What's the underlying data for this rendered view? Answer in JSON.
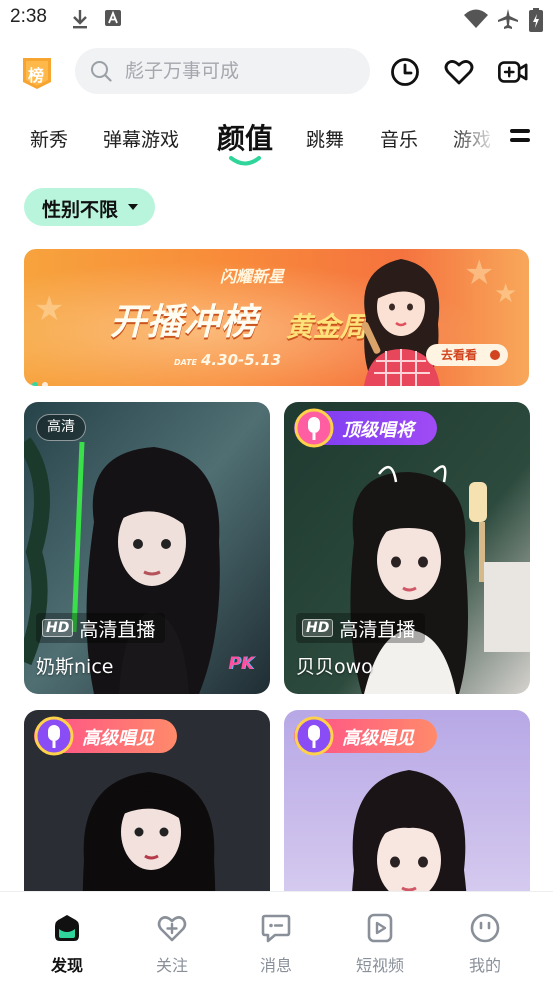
{
  "status_bar": {
    "time": "2:38",
    "icons": [
      "download-icon",
      "text-a-icon",
      "wifi-icon",
      "airplane-mode-icon",
      "battery-charging-icon"
    ]
  },
  "header": {
    "rank_badge_label": "榜",
    "search_placeholder": "彪子万事可成",
    "actions": [
      "history-clock-icon",
      "favorite-heart-icon",
      "start-live-camera-icon"
    ]
  },
  "tabs": {
    "items": [
      "新秀",
      "弹幕游戏",
      "颜值",
      "跳舞",
      "音乐",
      "游戏"
    ],
    "active": "颜值"
  },
  "filter": {
    "label": "性别不限"
  },
  "banner": {
    "small_title": "闪耀新星",
    "title_main": "开播冲榜",
    "title_sub": "黄金周",
    "date_prefix": "DATE",
    "date": "4.30-5.13",
    "cta": "去看看",
    "slides": 2,
    "active_slide": 1
  },
  "cards": [
    {
      "name": "奶斯nice",
      "quality": "高清",
      "hd_label": "高清直播",
      "hd_mark": "HD",
      "pk": "PK"
    },
    {
      "name": "贝贝owo",
      "badge": "顶级唱将",
      "hd_label": "高清直播",
      "hd_mark": "HD"
    },
    {
      "badge": "高级唱见"
    },
    {
      "badge": "高级唱见"
    }
  ],
  "bottom_nav": {
    "items": [
      {
        "label": "发现",
        "icon": "home-discover-icon",
        "active": true
      },
      {
        "label": "关注",
        "icon": "heart-plus-icon",
        "active": false
      },
      {
        "label": "消息",
        "icon": "message-bubble-icon",
        "active": false
      },
      {
        "label": "短视频",
        "icon": "short-video-icon",
        "active": false
      },
      {
        "label": "我的",
        "icon": "profile-face-icon",
        "active": false
      }
    ]
  },
  "colors": {
    "accent": "#2fd59a",
    "filter_bg": "#b9f5dd",
    "banner_orange": "#f88b3a",
    "badge_purple": "#6b3cf0",
    "badge_pink": "#ff5a8a"
  }
}
